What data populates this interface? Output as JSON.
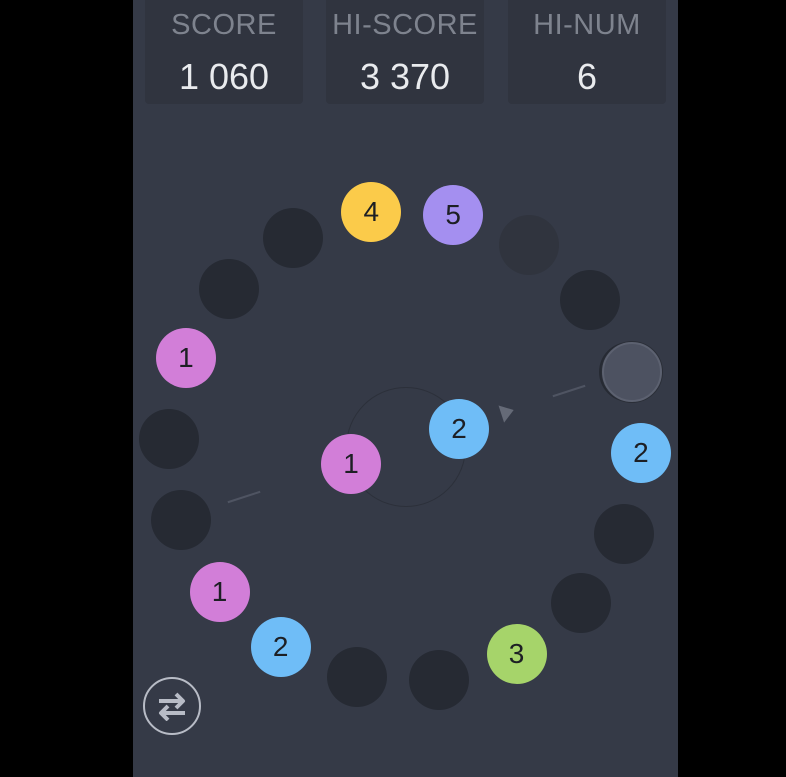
{
  "stats": {
    "score": {
      "label": "SCORE",
      "value": "1 060"
    },
    "hiscore": {
      "label": "HI-SCORE",
      "value": "3 370"
    },
    "hinum": {
      "label": "HI-NUM",
      "value": "6"
    }
  },
  "ring": {
    "slot_count": 18,
    "balls": [
      {
        "slot": 0,
        "value": "5",
        "color": "#a48ff0"
      },
      {
        "slot": 4,
        "value": "2",
        "color": "#6fbdf7"
      },
      {
        "slot": 7,
        "value": "3",
        "color": "#a6d46a"
      },
      {
        "slot": 10,
        "value": "2",
        "color": "#6fbdf7"
      },
      {
        "slot": 11,
        "value": "1",
        "color": "#d27ed8"
      },
      {
        "slot": 14,
        "value": "1",
        "color": "#d27ed8"
      },
      {
        "slot": 17,
        "value": "4",
        "color": "#fbcb4a"
      }
    ],
    "empty_faded_slot": 1
  },
  "center_balls": [
    {
      "value": "2",
      "color": "#6fbdf7"
    },
    {
      "value": "1",
      "color": "#d27ed8"
    }
  ],
  "controls": {
    "swap_icon": "swap-arrows-icon"
  },
  "colors": {
    "background": "#353a47",
    "slot": "#262a33",
    "panel": "#30343f"
  }
}
